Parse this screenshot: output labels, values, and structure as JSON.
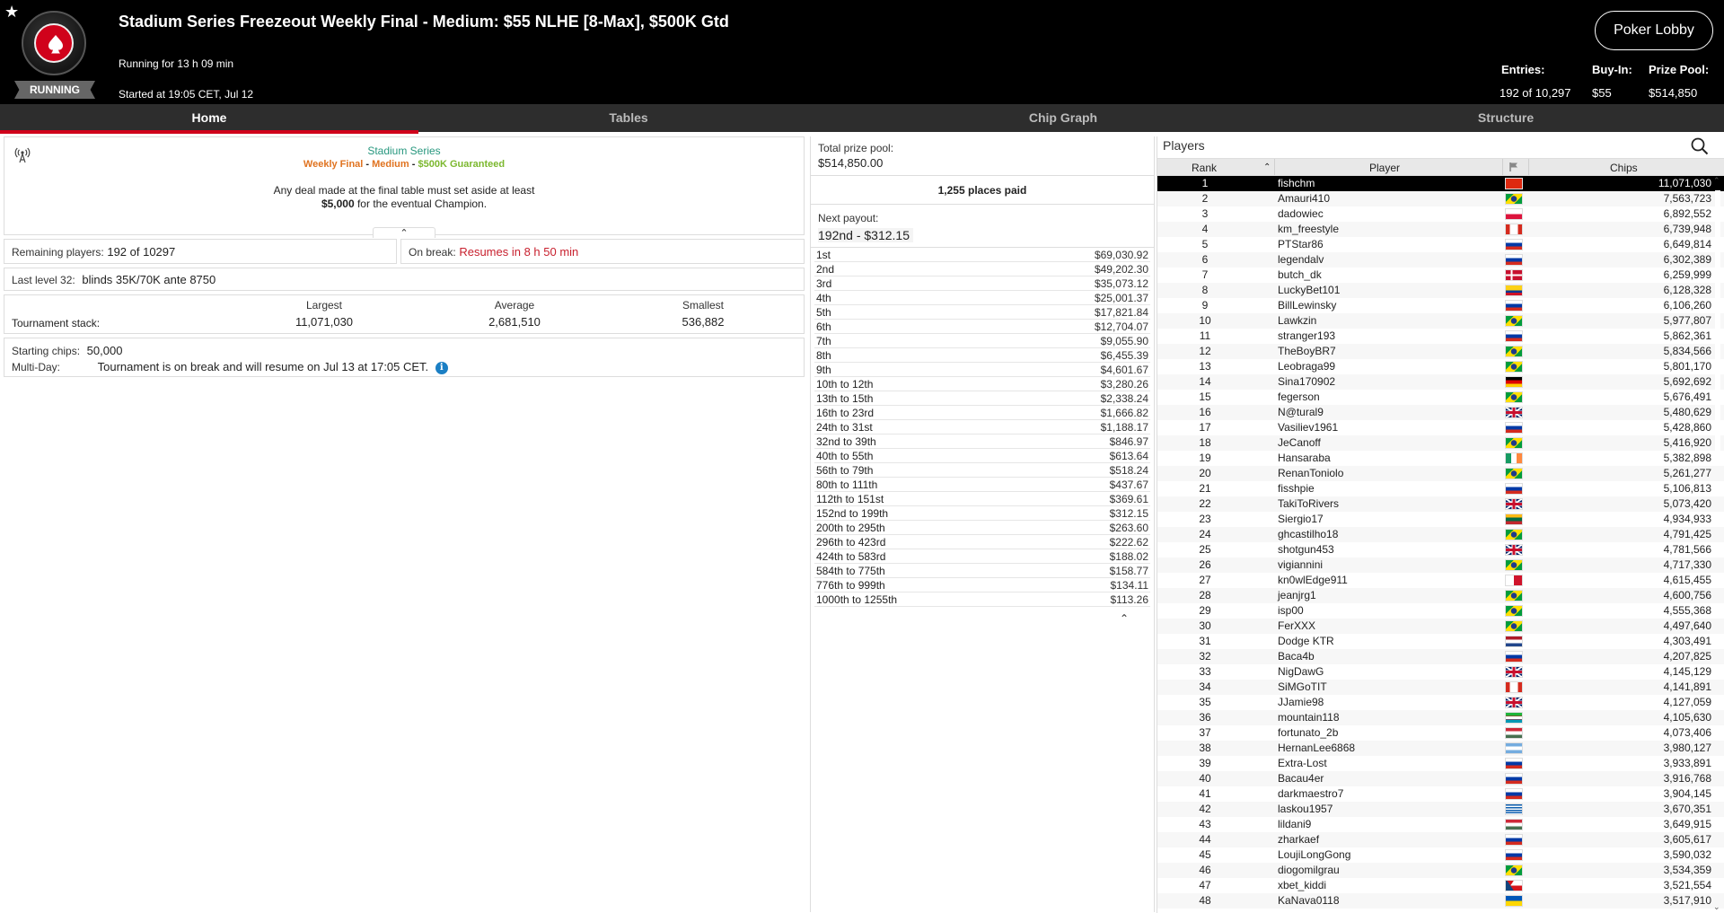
{
  "header": {
    "title": "Stadium Series Freezeout Weekly Final - Medium: $55 NLHE [8-Max], $500K Gtd",
    "running_for": "Running for 13 h 09 min",
    "started_at": "Started at 19:05 CET, Jul 12",
    "status": "RUNNING",
    "lobby_button": "Poker Lobby",
    "entries_label": "Entries:",
    "entries_value": "192 of 10,297",
    "buyin_label": "Buy-In:",
    "buyin_value": "$55",
    "prize_label": "Prize Pool:",
    "prize_value": "$514,850"
  },
  "tabs": [
    {
      "label": "Home",
      "active": true
    },
    {
      "label": "Tables",
      "active": false
    },
    {
      "label": "Chip Graph",
      "active": false
    },
    {
      "label": "Structure",
      "active": false
    }
  ],
  "info": {
    "series_name": "Stadium Series",
    "sub_weekly": "Weekly Final",
    "sub_medium": "Medium",
    "sub_gtd": "$500K Guaranteed",
    "deal_line1": "Any deal made at the final table must set aside at least",
    "deal_amount": "$5,000",
    "deal_line2": " for the eventual Champion.",
    "remaining_label": "Remaining players:",
    "remaining_value": "192 of 10297",
    "break_label": "On break:",
    "break_value": "Resumes in 8 h 50 min",
    "level_label": "Last level 32:",
    "level_value": "blinds 35K/70K ante 8750",
    "stack_label": "Tournament stack:",
    "largest_label": "Largest",
    "largest_value": "11,071,030",
    "average_label": "Average",
    "average_value": "2,681,510",
    "smallest_label": "Smallest",
    "smallest_value": "536,882",
    "starting_label": "Starting chips:",
    "starting_value": "50,000",
    "multiday_label": "Multi-Day:",
    "multiday_value": "Tournament is on break and will resume on Jul 13 at 17:05 CET."
  },
  "payout": {
    "total_label": "Total prize pool:",
    "total_value": "$514,850.00",
    "places_paid": "1,255 places paid",
    "next_label": "Next payout:",
    "next_value": "192nd - $312.15",
    "rows": [
      {
        "place": "1st",
        "amount": "$69,030.92"
      },
      {
        "place": "2nd",
        "amount": "$49,202.30"
      },
      {
        "place": "3rd",
        "amount": "$35,073.12"
      },
      {
        "place": "4th",
        "amount": "$25,001.37"
      },
      {
        "place": "5th",
        "amount": "$17,821.84"
      },
      {
        "place": "6th",
        "amount": "$12,704.07"
      },
      {
        "place": "7th",
        "amount": "$9,055.90"
      },
      {
        "place": "8th",
        "amount": "$6,455.39"
      },
      {
        "place": "9th",
        "amount": "$4,601.67"
      },
      {
        "place": "10th to 12th",
        "amount": "$3,280.26"
      },
      {
        "place": "13th to 15th",
        "amount": "$2,338.24"
      },
      {
        "place": "16th to 23rd",
        "amount": "$1,666.82"
      },
      {
        "place": "24th to 31st",
        "amount": "$1,188.17"
      },
      {
        "place": "32nd to 39th",
        "amount": "$846.97"
      },
      {
        "place": "40th to 55th",
        "amount": "$613.64"
      },
      {
        "place": "56th to 79th",
        "amount": "$518.24"
      },
      {
        "place": "80th to 111th",
        "amount": "$437.67"
      },
      {
        "place": "112th to 151st",
        "amount": "$369.61"
      },
      {
        "place": "152nd to 199th",
        "amount": "$312.15"
      },
      {
        "place": "200th to 295th",
        "amount": "$263.60"
      },
      {
        "place": "296th to 423rd",
        "amount": "$222.62"
      },
      {
        "place": "424th to 583rd",
        "amount": "$188.02"
      },
      {
        "place": "584th to 775th",
        "amount": "$158.77"
      },
      {
        "place": "776th to 999th",
        "amount": "$134.11"
      },
      {
        "place": "1000th to 1255th",
        "amount": "$113.26"
      }
    ]
  },
  "players": {
    "title": "Players",
    "col_rank": "Rank",
    "col_player": "Player",
    "col_chips": "Chips",
    "rows": [
      {
        "rank": "1",
        "name": "fishchm",
        "flag": "cn",
        "chips": "11,071,030"
      },
      {
        "rank": "2",
        "name": "Amauri410",
        "flag": "br",
        "chips": "7,563,723"
      },
      {
        "rank": "3",
        "name": "dadowiec",
        "flag": "pl",
        "chips": "6,892,552"
      },
      {
        "rank": "4",
        "name": "km_freestyle",
        "flag": "ca",
        "chips": "6,739,948"
      },
      {
        "rank": "5",
        "name": "PTStar86",
        "flag": "ru",
        "chips": "6,649,814"
      },
      {
        "rank": "6",
        "name": "legendalv",
        "flag": "ru",
        "chips": "6,302,389"
      },
      {
        "rank": "7",
        "name": "butch_dk",
        "flag": "dk",
        "chips": "6,259,999"
      },
      {
        "rank": "8",
        "name": "LuckyBet101",
        "flag": "co",
        "chips": "6,128,328"
      },
      {
        "rank": "9",
        "name": "BillLewinsky",
        "flag": "ru",
        "chips": "6,106,260"
      },
      {
        "rank": "10",
        "name": "Lawkzin",
        "flag": "br",
        "chips": "5,977,807"
      },
      {
        "rank": "11",
        "name": "stranger193",
        "flag": "ru",
        "chips": "5,862,361"
      },
      {
        "rank": "12",
        "name": "TheBoyBR7",
        "flag": "br",
        "chips": "5,834,566"
      },
      {
        "rank": "13",
        "name": "Leobraga99",
        "flag": "br",
        "chips": "5,801,170"
      },
      {
        "rank": "14",
        "name": "Sina170902",
        "flag": "de",
        "chips": "5,692,692"
      },
      {
        "rank": "15",
        "name": "fegerson",
        "flag": "br",
        "chips": "5,676,491"
      },
      {
        "rank": "16",
        "name": "N@tural9",
        "flag": "gb",
        "chips": "5,480,629"
      },
      {
        "rank": "17",
        "name": "Vasiliev1961",
        "flag": "ru",
        "chips": "5,428,860"
      },
      {
        "rank": "18",
        "name": "JeCanoff",
        "flag": "br",
        "chips": "5,416,920"
      },
      {
        "rank": "19",
        "name": "Hansaraba",
        "flag": "ie",
        "chips": "5,382,898"
      },
      {
        "rank": "20",
        "name": "RenanToniolo",
        "flag": "br",
        "chips": "5,261,277"
      },
      {
        "rank": "21",
        "name": "fisshpie",
        "flag": "ru",
        "chips": "5,106,813"
      },
      {
        "rank": "22",
        "name": "TakiToRivers",
        "flag": "gb",
        "chips": "5,073,420"
      },
      {
        "rank": "23",
        "name": "Siergio17",
        "flag": "lt",
        "chips": "4,934,933"
      },
      {
        "rank": "24",
        "name": "ghcastilho18",
        "flag": "br",
        "chips": "4,791,425"
      },
      {
        "rank": "25",
        "name": "shotgun453",
        "flag": "gb",
        "chips": "4,781,566"
      },
      {
        "rank": "26",
        "name": "vigiannini",
        "flag": "br",
        "chips": "4,717,330"
      },
      {
        "rank": "27",
        "name": "kn0wlEdge911",
        "flag": "mt",
        "chips": "4,615,455"
      },
      {
        "rank": "28",
        "name": "jeanjrg1",
        "flag": "br",
        "chips": "4,600,756"
      },
      {
        "rank": "29",
        "name": "isp00",
        "flag": "br",
        "chips": "4,555,368"
      },
      {
        "rank": "30",
        "name": "FerXXX",
        "flag": "br",
        "chips": "4,497,640"
      },
      {
        "rank": "31",
        "name": "Dodge KTR",
        "flag": "nl",
        "chips": "4,303,491"
      },
      {
        "rank": "32",
        "name": "Baca4b",
        "flag": "ru",
        "chips": "4,207,825"
      },
      {
        "rank": "33",
        "name": "NigDawG",
        "flag": "gb",
        "chips": "4,145,129"
      },
      {
        "rank": "34",
        "name": "SiMGoTIT",
        "flag": "ca",
        "chips": "4,141,891"
      },
      {
        "rank": "35",
        "name": "JJamie98",
        "flag": "gb",
        "chips": "4,127,059"
      },
      {
        "rank": "36",
        "name": "mountain118",
        "flag": "uz",
        "chips": "4,105,630"
      },
      {
        "rank": "37",
        "name": "fortunato_2b",
        "flag": "hu",
        "chips": "4,073,406"
      },
      {
        "rank": "38",
        "name": "HernanLee6868",
        "flag": "ar",
        "chips": "3,980,127"
      },
      {
        "rank": "39",
        "name": "Extra-Lost",
        "flag": "ru",
        "chips": "3,933,891"
      },
      {
        "rank": "40",
        "name": "Bacau4er",
        "flag": "ru",
        "chips": "3,916,768"
      },
      {
        "rank": "41",
        "name": "darkmaestro7",
        "flag": "ru",
        "chips": "3,904,145"
      },
      {
        "rank": "42",
        "name": "laskou1957",
        "flag": "gr",
        "chips": "3,670,351"
      },
      {
        "rank": "43",
        "name": "lildani9",
        "flag": "hu",
        "chips": "3,649,915"
      },
      {
        "rank": "44",
        "name": "zharkaef",
        "flag": "ru",
        "chips": "3,605,617"
      },
      {
        "rank": "45",
        "name": "LoujiLongGong",
        "flag": "ru",
        "chips": "3,590,032"
      },
      {
        "rank": "46",
        "name": "diogomilgrau",
        "flag": "br",
        "chips": "3,534,359"
      },
      {
        "rank": "47",
        "name": "xbet_kiddi",
        "flag": "cz",
        "chips": "3,521,554"
      },
      {
        "rank": "48",
        "name": "KaNava0118",
        "flag": "ua",
        "chips": "3,517,910"
      }
    ]
  },
  "colors": {
    "accent": "#d0021b",
    "series_green": "#27977e",
    "orange": "#e07320",
    "gtd_green": "#7cb82f",
    "break_red": "#c8202e"
  }
}
